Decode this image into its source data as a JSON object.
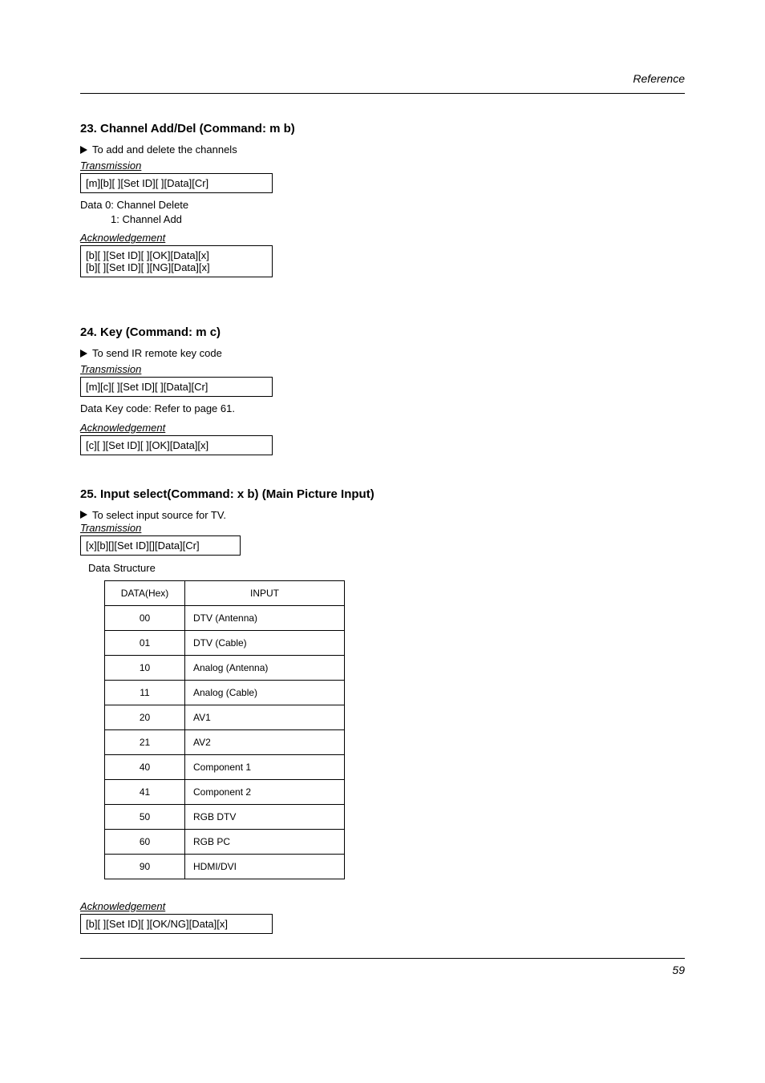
{
  "header": {
    "section": "Reference"
  },
  "s23": {
    "title": "23. Channel Add/Del (Command: m b)",
    "desc": "To add and delete the channels",
    "trans_label": "Transmission",
    "trans_code": "[m][b][  ][Set ID][  ][Data][Cr]",
    "data_l1": "Data  0: Channel Delete",
    "data_l2": "1: Channel Add",
    "ack_label": "Acknowledgement",
    "ack_l1": "[b][  ][Set ID][  ][OK][Data][x]",
    "ack_l2": "[b][  ][Set ID][  ][NG][Data][x]"
  },
  "s24": {
    "title": "24. Key (Command: m c)",
    "desc": "To send IR remote key code",
    "trans_label": "Transmission",
    "trans_code": "[m][c][  ][Set ID][  ][Data][Cr]",
    "data_l1": "Data  Key code: Refer to page 61.",
    "ack_label": "Acknowledgement",
    "ack_code": "[c][  ][Set ID][  ][OK][Data][x]"
  },
  "s25": {
    "title": "25. Input select(Command: x b) (Main Picture Input)",
    "desc": "To select input source for TV.",
    "trans_label": "Transmission",
    "trans_code": "[x][b][][Set ID][][Data][Cr]",
    "ds_label": "Data Structure",
    "th_hex": "DATA(Hex)",
    "th_input": "INPUT",
    "rows": [
      {
        "hex": "00",
        "input": "DTV (Antenna)"
      },
      {
        "hex": "01",
        "input": "DTV (Cable)"
      },
      {
        "hex": "10",
        "input": "Analog (Antenna)"
      },
      {
        "hex": "11",
        "input": "Analog (Cable)"
      },
      {
        "hex": "20",
        "input": "AV1"
      },
      {
        "hex": "21",
        "input": "AV2"
      },
      {
        "hex": "40",
        "input": "Component 1"
      },
      {
        "hex": "41",
        "input": "Component 2"
      },
      {
        "hex": "50",
        "input": "RGB DTV"
      },
      {
        "hex": "60",
        "input": "RGB PC"
      },
      {
        "hex": "90",
        "input": "HDMI/DVI"
      }
    ],
    "ack_label": "Acknowledgement",
    "ack_code": "[b][  ][Set ID][  ][OK/NG][Data][x]"
  },
  "footer": {
    "page": "59"
  }
}
